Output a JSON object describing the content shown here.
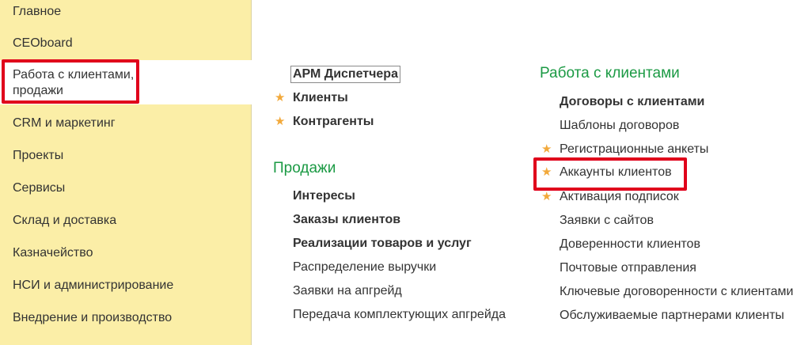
{
  "sidebar": {
    "items": [
      {
        "label": "Главное"
      },
      {
        "label": "CEOboard"
      },
      {
        "label": "Работа с клиентами,\nпродажи"
      },
      {
        "label": "CRM и маркетинг"
      },
      {
        "label": "Проекты"
      },
      {
        "label": "Сервисы"
      },
      {
        "label": "Склад и доставка"
      },
      {
        "label": "Казначейство"
      },
      {
        "label": "НСИ и администрирование"
      },
      {
        "label": "Внедрение и производство"
      }
    ],
    "active_line1": "Работа с клиентами,",
    "active_line2": "продажи"
  },
  "main": {
    "top_links": [
      {
        "label": "АРМ Диспетчера",
        "bold": true,
        "starred": false
      },
      {
        "label": "Клиенты",
        "bold": true,
        "starred": true
      },
      {
        "label": "Контрагенты",
        "bold": true,
        "starred": true
      }
    ],
    "sales": {
      "title": "Продажи",
      "links": [
        {
          "label": "Интересы"
        },
        {
          "label": "Заказы клиентов"
        },
        {
          "label": "Реализации товаров и услуг"
        },
        {
          "label": "Распределение выручки"
        },
        {
          "label": "Заявки на апгрейд"
        },
        {
          "label": "Передача комплектующих апгрейда"
        }
      ]
    },
    "clients": {
      "title": "Работа с клиентами",
      "links": [
        {
          "label": "Договоры с клиентами"
        },
        {
          "label": "Шаблоны договоров"
        },
        {
          "label": "Регистрационные анкеты"
        },
        {
          "label": "Аккаунты клиентов"
        },
        {
          "label": "Активация подписок"
        },
        {
          "label": "Заявки с сайтов"
        },
        {
          "label": "Доверенности клиентов"
        },
        {
          "label": "Почтовые отправления"
        },
        {
          "label": "Ключевые договоренности с клиентами"
        },
        {
          "label": "Обслуживаемые партнерами клиенты"
        }
      ]
    }
  },
  "colors": {
    "accent_green": "#1b9a44",
    "sidebar_bg": "#fbeea7",
    "star": "#f2a93b",
    "highlight_red": "#e0001b"
  },
  "icons": {
    "favorite": "star-icon"
  }
}
